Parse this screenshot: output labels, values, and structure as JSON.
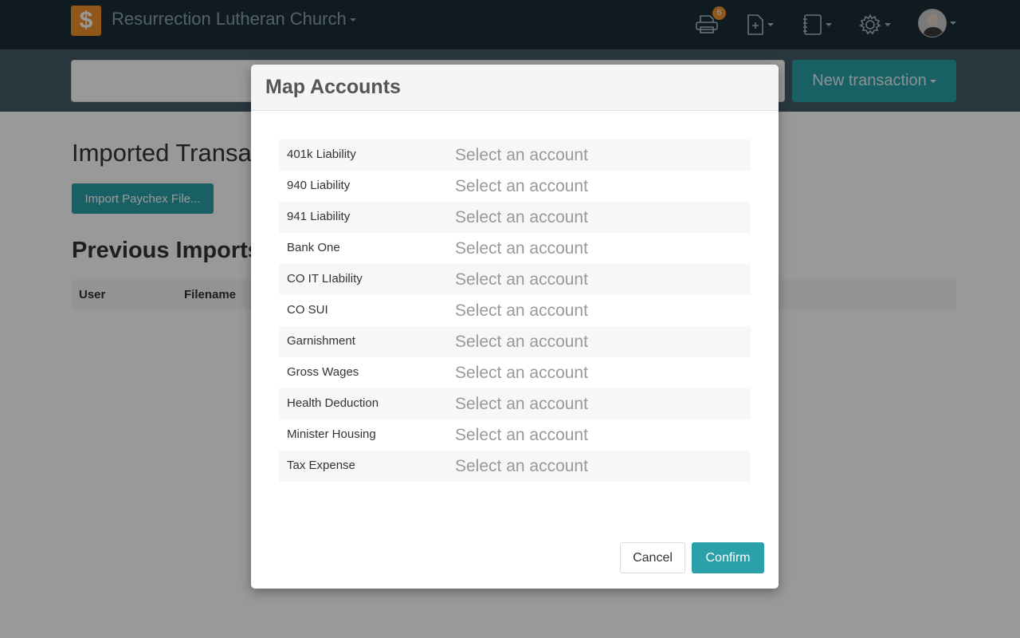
{
  "navbar": {
    "logo_glyph": "$",
    "org_name": "Resurrection Lutheran Church",
    "print_badge_count": "6",
    "icons": [
      "printer-icon",
      "new-document-icon",
      "notebook-icon",
      "gear-icon",
      "avatar"
    ]
  },
  "subbar": {
    "search_placeholder": "",
    "new_transaction_label": "New transaction"
  },
  "page": {
    "title": "Imported Transactions",
    "import_button_label": "Import Paychex File...",
    "previous_imports_title": "Previous Imports",
    "table_columns": [
      "User",
      "Filename"
    ]
  },
  "modal": {
    "title": "Map Accounts",
    "rows": [
      {
        "label": "401k Liability",
        "select": "Select an account"
      },
      {
        "label": "940 Liability",
        "select": "Select an account"
      },
      {
        "label": "941 Liability",
        "select": "Select an account"
      },
      {
        "label": "Bank One",
        "select": "Select an account"
      },
      {
        "label": "CO IT LIability",
        "select": "Select an account"
      },
      {
        "label": "CO SUI",
        "select": "Select an account"
      },
      {
        "label": "Garnishment",
        "select": "Select an account"
      },
      {
        "label": "Gross Wages",
        "select": "Select an account"
      },
      {
        "label": "Health Deduction",
        "select": "Select an account"
      },
      {
        "label": "Minister Housing",
        "select": "Select an account"
      },
      {
        "label": "Tax Expense",
        "select": "Select an account"
      }
    ],
    "cancel_label": "Cancel",
    "confirm_label": "Confirm"
  },
  "colors": {
    "navbar_bg": "#1a2e38",
    "accent_teal": "#2aa0a8",
    "logo_orange": "#f0922b"
  }
}
